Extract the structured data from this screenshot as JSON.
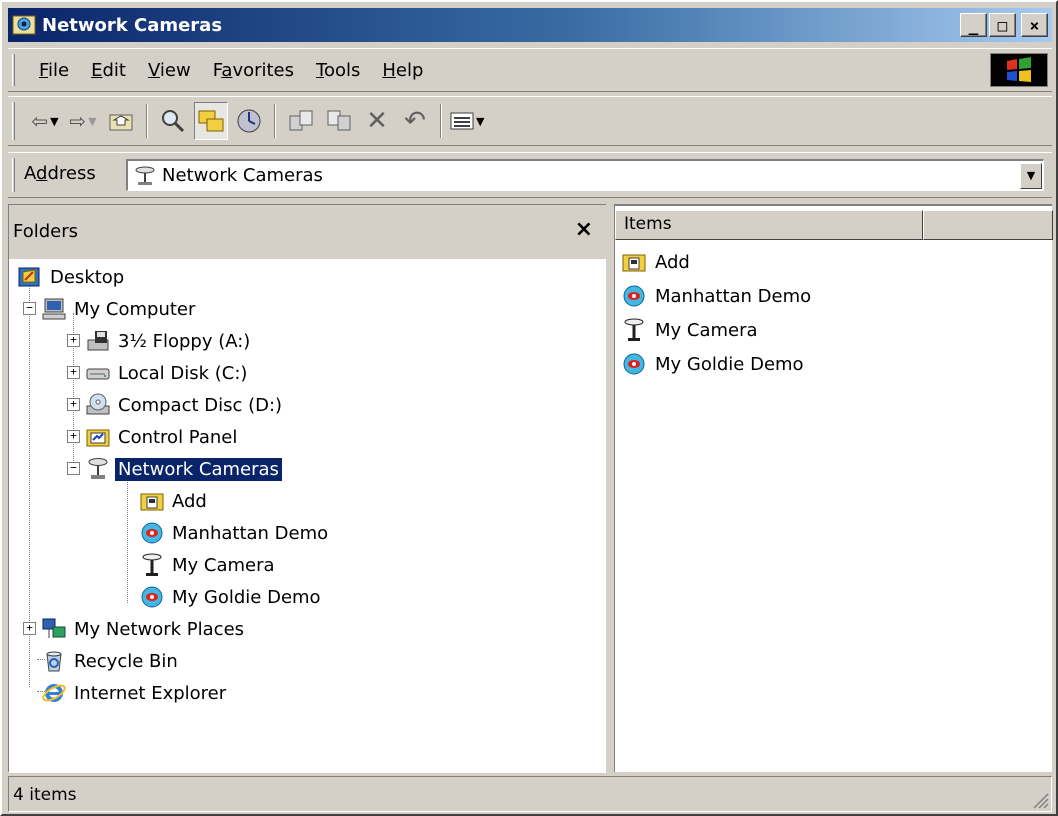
{
  "window": {
    "title": "Network Cameras",
    "minimize": "_",
    "maximize": "□",
    "close": "×"
  },
  "menu": [
    {
      "key": "F",
      "rest": "ile"
    },
    {
      "key": "E",
      "rest": "dit"
    },
    {
      "key": "V",
      "rest": "iew"
    },
    {
      "pre": "F",
      "key": "a",
      "rest": "vorites"
    },
    {
      "key": "T",
      "rest": "ools"
    },
    {
      "key": "H",
      "rest": "elp"
    }
  ],
  "toolbar": {
    "back": "⇦",
    "forward": "⇨",
    "up": "up-folder-icon",
    "search": "search-icon",
    "folders": "folders-icon",
    "history": "history-icon",
    "move_to": "move-to-icon",
    "copy_to": "copy-to-icon",
    "delete": "✕",
    "undo": "↶",
    "views": "views-icon"
  },
  "address": {
    "label_pre": "A",
    "label_key": "d",
    "label_rest": "dress",
    "value": "Network Cameras"
  },
  "folders_pane": {
    "title": "Folders",
    "close": "×",
    "tree": [
      {
        "label": "Desktop",
        "icon": "desktop-icon"
      },
      {
        "label": "My Computer",
        "icon": "my-computer-icon",
        "expander": "−"
      },
      {
        "label": "3½ Floppy (A:)",
        "icon": "floppy-icon",
        "expander": "+"
      },
      {
        "label": "Local Disk (C:)",
        "icon": "local-disk-icon",
        "expander": "+"
      },
      {
        "label": "Compact Disc (D:)",
        "icon": "compact-disc-icon",
        "expander": "+"
      },
      {
        "label": "Control Panel",
        "icon": "control-panel-icon",
        "expander": "+"
      },
      {
        "label": "Network Cameras",
        "icon": "network-camera-icon",
        "expander": "−",
        "selected": true
      },
      {
        "label": "Add",
        "icon": "add-folder-icon"
      },
      {
        "label": "Manhattan Demo",
        "icon": "goldie-camera-icon"
      },
      {
        "label": "My Camera",
        "icon": "camera-antenna-icon"
      },
      {
        "label": "My Goldie Demo",
        "icon": "goldie-camera-icon"
      },
      {
        "label": "My Network Places",
        "icon": "network-places-icon",
        "expander": "+"
      },
      {
        "label": "Recycle Bin",
        "icon": "recycle-bin-icon"
      },
      {
        "label": "Internet Explorer",
        "icon": "internet-explorer-icon"
      }
    ]
  },
  "items_pane": {
    "columns": [
      "Items",
      ""
    ],
    "items": [
      {
        "label": "Add",
        "icon": "add-folder-icon"
      },
      {
        "label": "Manhattan Demo",
        "icon": "goldie-camera-icon"
      },
      {
        "label": "My Camera",
        "icon": "camera-antenna-icon"
      },
      {
        "label": "My Goldie Demo",
        "icon": "goldie-camera-icon"
      }
    ]
  },
  "status": {
    "text": "4 items"
  },
  "colors": {
    "face": "#d4d0c8",
    "title_start": "#0a246a",
    "title_end": "#a6caf0",
    "selection": "#0a246a"
  }
}
